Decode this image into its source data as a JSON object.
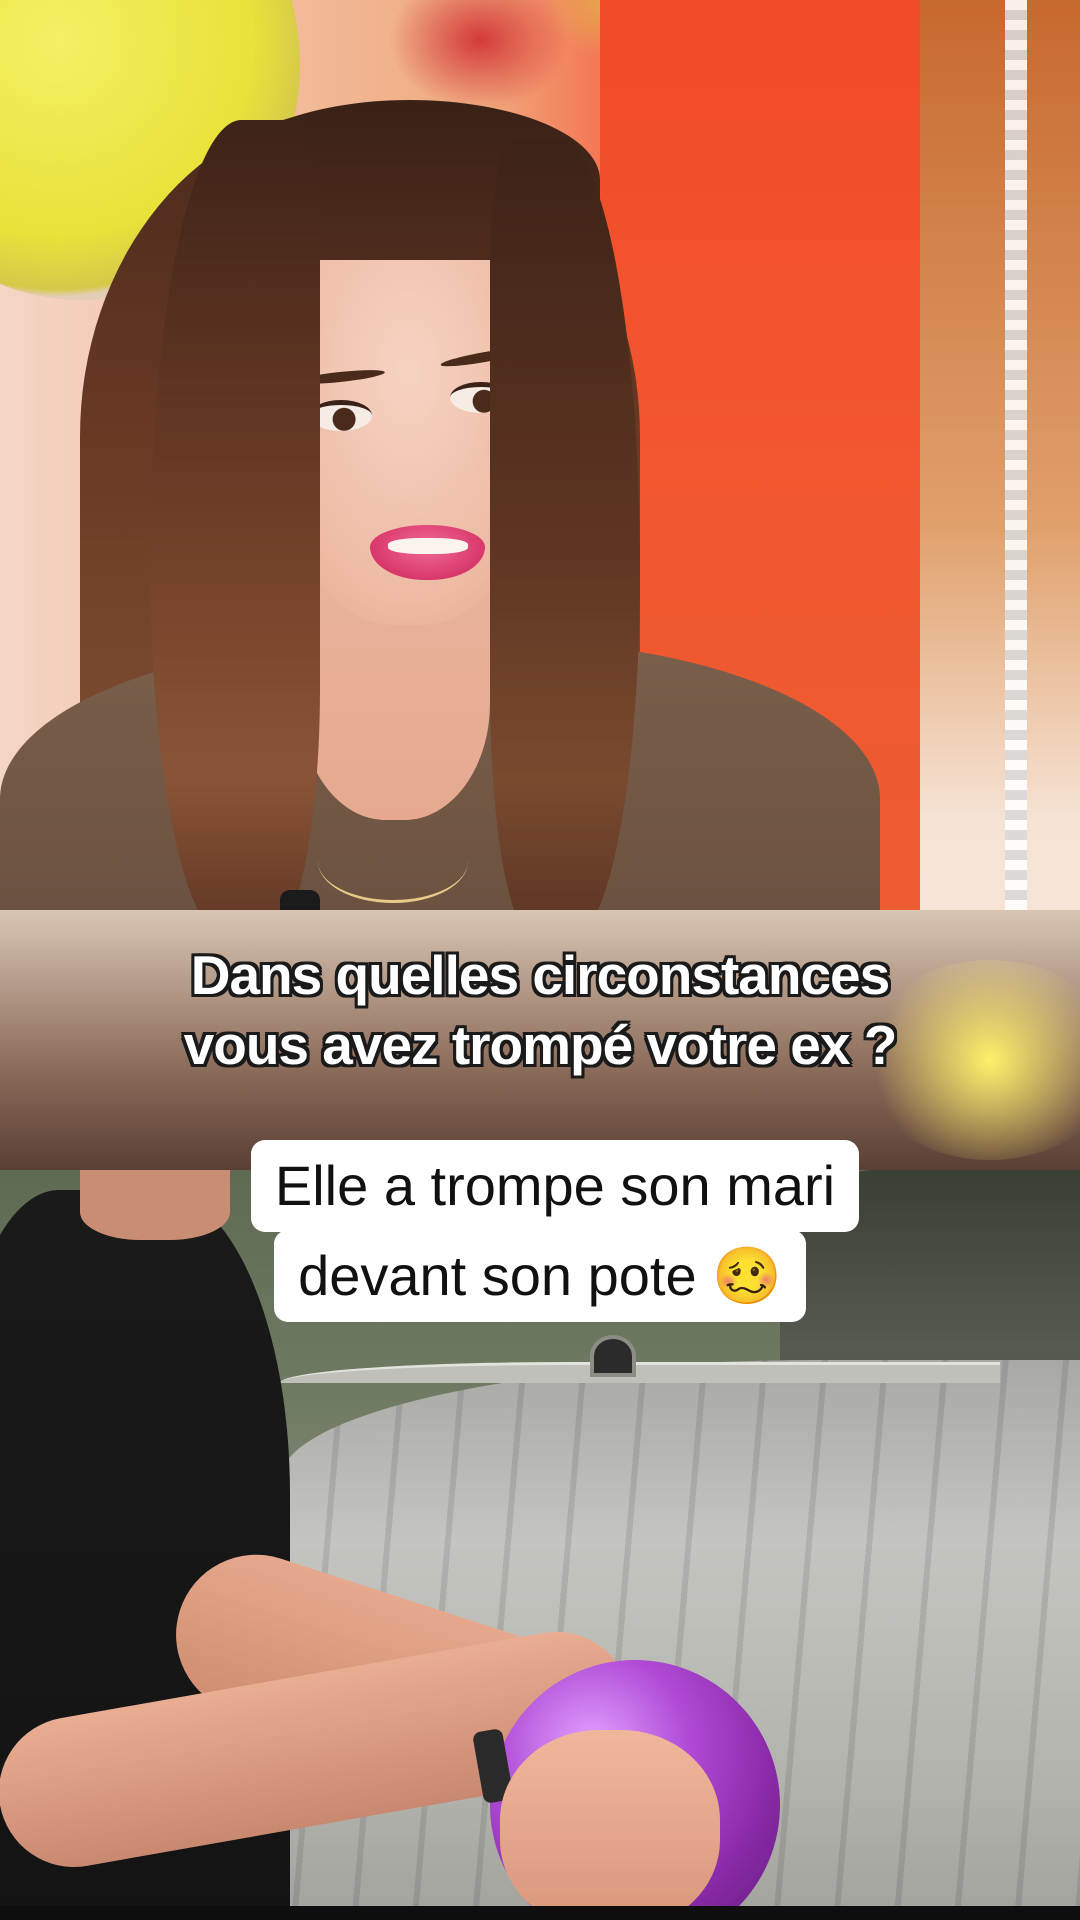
{
  "top_video": {
    "subtitle_line1": "Dans quelles circonstances",
    "subtitle_line2": "vous avez trompé votre ex ?"
  },
  "caption": {
    "line1": "Elle a trompe son mari",
    "line2": "devant son pote 🥴"
  },
  "colors": {
    "caption_bg": "#ffffff",
    "caption_text": "#111111",
    "subtitle_text": "#ffffff",
    "subtitle_outline": "#1a1a1a",
    "studio_red": "#f3572f",
    "bowling_ball": "#b04ad6"
  }
}
